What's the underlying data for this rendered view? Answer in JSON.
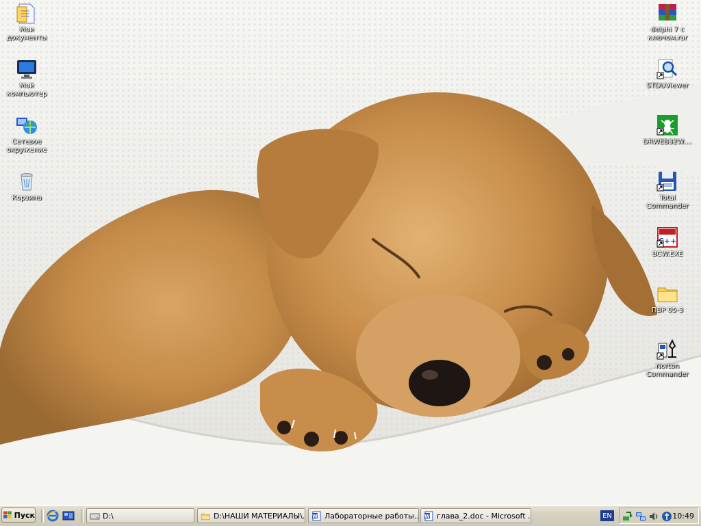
{
  "desktop": {
    "left_icons": [
      {
        "name": "my-documents",
        "lines": [
          "Мои",
          "документы"
        ],
        "icon": "folder-documents-icon"
      },
      {
        "name": "my-computer",
        "lines": [
          "Мой",
          "компьютер"
        ],
        "icon": "monitor-icon"
      },
      {
        "name": "network-places",
        "lines": [
          "Сетевое",
          "окружение"
        ],
        "icon": "network-globe-icon"
      },
      {
        "name": "recycle-bin",
        "lines": [
          "Корзина"
        ],
        "icon": "recycle-bin-icon"
      }
    ],
    "right_icons": [
      {
        "name": "delphi-archive",
        "lines": [
          "delphi 7 с",
          "ключом.rar"
        ],
        "icon": "winrar-archive-icon"
      },
      {
        "name": "stduviewer",
        "lines": [
          "STDUViewer"
        ],
        "icon": "magnifier-shortcut-icon"
      },
      {
        "name": "drweb",
        "lines": [
          "DRWEB32W...."
        ],
        "icon": "drweb-spider-icon"
      },
      {
        "name": "total-commander",
        "lines": [
          "Total",
          "Commander"
        ],
        "icon": "floppy-shortcut-icon"
      },
      {
        "name": "bcw-exe",
        "lines": [
          "BCW.EXE"
        ],
        "icon": "cpp-shortcut-icon"
      },
      {
        "name": "pvr-folder",
        "lines": [
          "ПВР 05-3"
        ],
        "icon": "folder-icon"
      },
      {
        "name": "norton-commander",
        "lines": [
          "Norton",
          "Commander"
        ],
        "icon": "norton-shortcut-icon"
      }
    ]
  },
  "taskbar": {
    "start_label": "Пуск",
    "quick_launch": [
      "internet-explorer-icon",
      "show-desktop-icon"
    ],
    "tasks": [
      {
        "label": "D:\\",
        "icon": "drive-icon"
      },
      {
        "label": "D:\\НАШИ МАТЕРИАЛЫ\\...",
        "icon": "folder-icon"
      },
      {
        "label": "Лабораторные работы....",
        "icon": "word-document-icon"
      },
      {
        "label": "глава_2.doc - Microsoft ...",
        "icon": "word-document-icon"
      }
    ],
    "language": "EN",
    "tray_icons": [
      "network-transfer-icon",
      "network-connections-icon",
      "volume-icon",
      "antivirus-icon"
    ],
    "clock": "10:49"
  },
  "colors": {
    "label_text": "#ffffff",
    "taskbar_bg": "#d6d2c2",
    "lang_bg": "#1f3d8f"
  }
}
